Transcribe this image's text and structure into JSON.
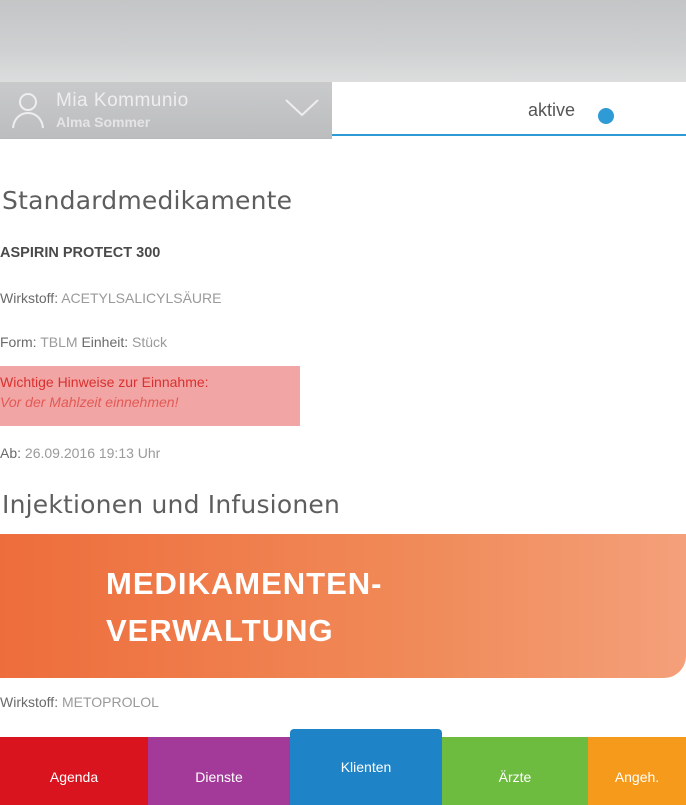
{
  "header": {
    "user_name": "Mia Kommunio",
    "user_sub": "Alma Sommer",
    "tab_label": "aktive"
  },
  "content": {
    "section1_title": "Standardmedikamente",
    "med_name": "ASPIRIN PROTECT 300",
    "wirkstoff_label": "Wirkstoff:",
    "wirkstoff_value": "ACETYLSALICYLSÄURE",
    "form_label": "Form:",
    "form_value": "TBLM",
    "einheit_label": "Einheit:",
    "einheit_value": "Stück",
    "alert_title": "Wichtige Hinweise zur Einnahme:",
    "alert_text": "Vor der Mahlzeit einnehmen!",
    "ab_label": "Ab:",
    "ab_value": "26.09.2016 19:13 Uhr",
    "section2_title": "Injektionen und Infusionen",
    "wirkstoff2_label": "Wirkstoff:",
    "wirkstoff2_value": "METOPROLOL"
  },
  "banner": {
    "line1": "MEDIKAMENTEN-",
    "line2": "VERWALTUNG"
  },
  "bottom_nav": {
    "agenda": "Agenda",
    "dienste": "Dienste",
    "klienten": "Klienten",
    "aerzte": "Ärzte",
    "more": "Angeh."
  },
  "colors": {
    "accent_blue": "#2e9bd6",
    "banner_orange": "#ee6d3c",
    "alert_bg": "#f2a5a5",
    "nav_agenda": "#d9141e",
    "nav_dienste": "#a33a9a",
    "nav_klienten": "#1f84c7",
    "nav_aerzte": "#6dbb3f",
    "nav_more": "#f59a1b"
  },
  "icons": {
    "user": "user-icon",
    "chevron": "chevron-down-icon",
    "status_dot": "status-dot-icon"
  }
}
